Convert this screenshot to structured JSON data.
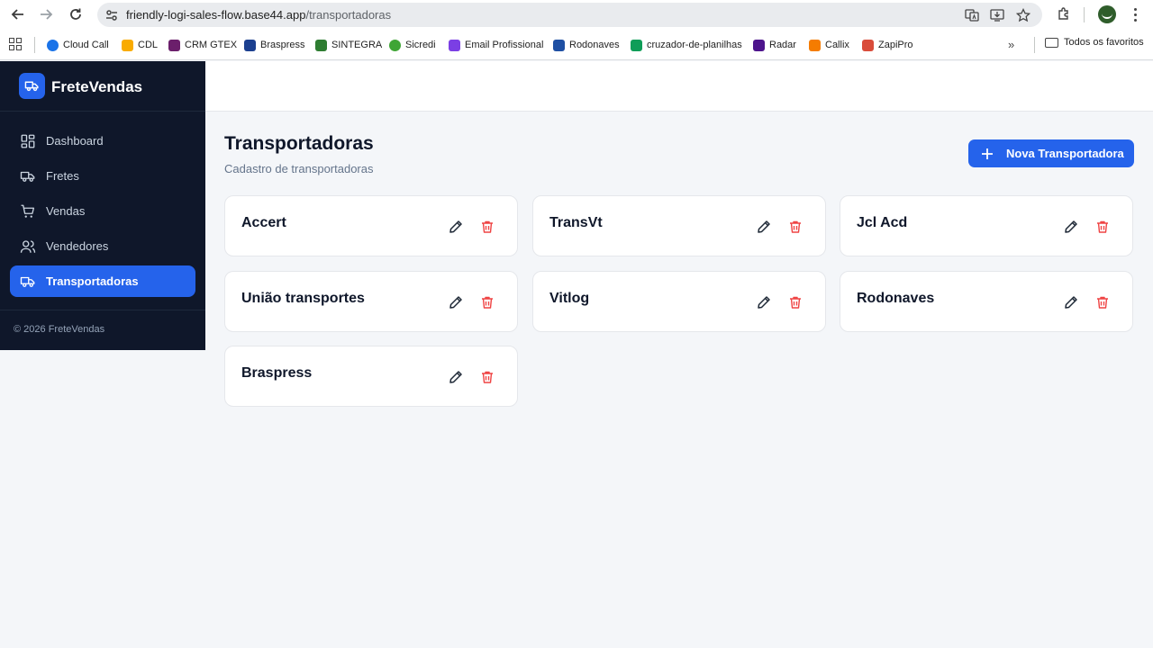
{
  "browser": {
    "url_host": "friendly-logi-sales-flow.base44.app",
    "url_path": "/transportadoras",
    "bookmarks": [
      {
        "label": "Cloud Call",
        "color": "#1a73e8"
      },
      {
        "label": "CDL",
        "color": "#f9ab00"
      },
      {
        "label": "CRM GTEX",
        "color": "#6b1f6b"
      },
      {
        "label": "Braspress",
        "color": "#1b3f8f"
      },
      {
        "label": "SINTEGRA",
        "color": "#2e7d32"
      },
      {
        "label": "Sicredi",
        "color": "#3fa535"
      },
      {
        "label": "Email Profissional",
        "color": "#7b3fe4"
      },
      {
        "label": "Rodonaves",
        "color": "#1e4fa3"
      },
      {
        "label": "cruzador-de-planilhas",
        "color": "#0f9d58"
      },
      {
        "label": "Radar",
        "color": "#4d148c"
      },
      {
        "label": "Callix",
        "color": "#f57c00"
      },
      {
        "label": "ZapiPro",
        "color": "#d94c3a"
      }
    ],
    "all_bookmarks_label": "Todos os favoritos"
  },
  "sidebar": {
    "brand": "FreteVendas",
    "items": [
      {
        "label": "Dashboard",
        "icon": "dashboard-icon",
        "active": false
      },
      {
        "label": "Fretes",
        "icon": "truck-icon",
        "active": false
      },
      {
        "label": "Vendas",
        "icon": "cart-icon",
        "active": false
      },
      {
        "label": "Vendedores",
        "icon": "users-icon",
        "active": false
      },
      {
        "label": "Transportadoras",
        "icon": "truck-icon",
        "active": true
      }
    ],
    "footer": "© 2026 FreteVendas"
  },
  "main": {
    "title": "Transportadoras",
    "subtitle": "Cadastro de transportadoras",
    "new_button_label": "Nova Transportadora",
    "carriers": [
      {
        "name": "Accert"
      },
      {
        "name": "TransVt"
      },
      {
        "name": "Jcl Acd"
      },
      {
        "name": "União transportes"
      },
      {
        "name": "Vitlog"
      },
      {
        "name": "Rodonaves"
      },
      {
        "name": "Braspress"
      }
    ]
  },
  "colors": {
    "sidebar_bg": "#0f172a",
    "accent": "#2563eb",
    "delete": "#ef4444",
    "page_bg": "#f4f6f9"
  }
}
